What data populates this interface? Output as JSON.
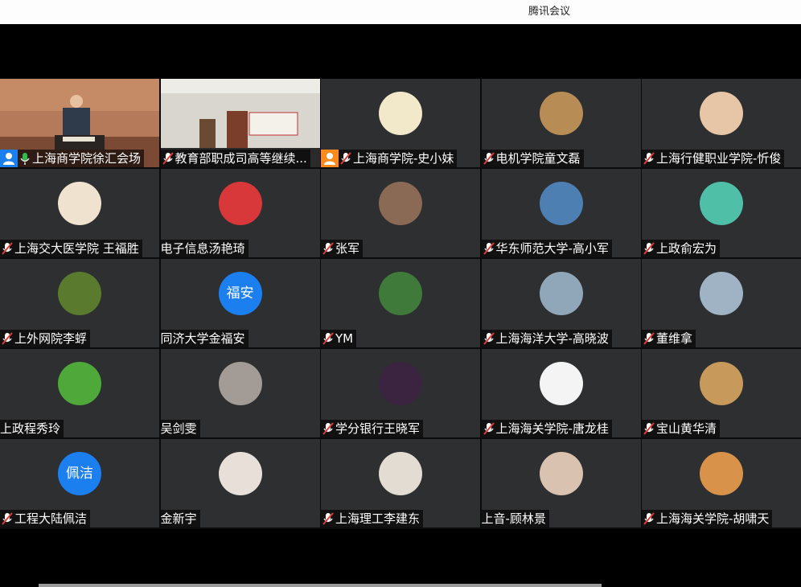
{
  "window": {
    "title": "腾讯会议"
  },
  "participants": [
    {
      "name": "上海商学院徐汇会场",
      "host": "blue"
    },
    {
      "name": "教育部职成司高等继续..."
    },
    {
      "name": "上海商学院-史小妹",
      "host": "orange"
    },
    {
      "name": "电机学院童文磊"
    },
    {
      "name": "上海行健职业学院-忻俊"
    },
    {
      "name": "上海交大医学院 王福胜"
    },
    {
      "name": "电子信息汤艳琦"
    },
    {
      "name": "张军"
    },
    {
      "name": "华东师范大学-高小军"
    },
    {
      "name": "上政俞宏为"
    },
    {
      "name": "上外网院李蜉"
    },
    {
      "name": "同济大学金福安",
      "initials": "福安"
    },
    {
      "name": "YM"
    },
    {
      "name": "上海海洋大学-高晓波"
    },
    {
      "name": "董维拿"
    },
    {
      "name": "上政程秀玲"
    },
    {
      "name": "吴剑雯"
    },
    {
      "name": "学分银行王晓军"
    },
    {
      "name": "上海海关学院-唐龙桂"
    },
    {
      "name": "宝山黄华清"
    },
    {
      "name": "工程大陆佩洁",
      "initials": "佩洁"
    },
    {
      "name": "金新宇"
    },
    {
      "name": "上海理工李建东"
    },
    {
      "name": "上音-顾林景"
    },
    {
      "name": "上海海关学院-胡啸天"
    }
  ]
}
